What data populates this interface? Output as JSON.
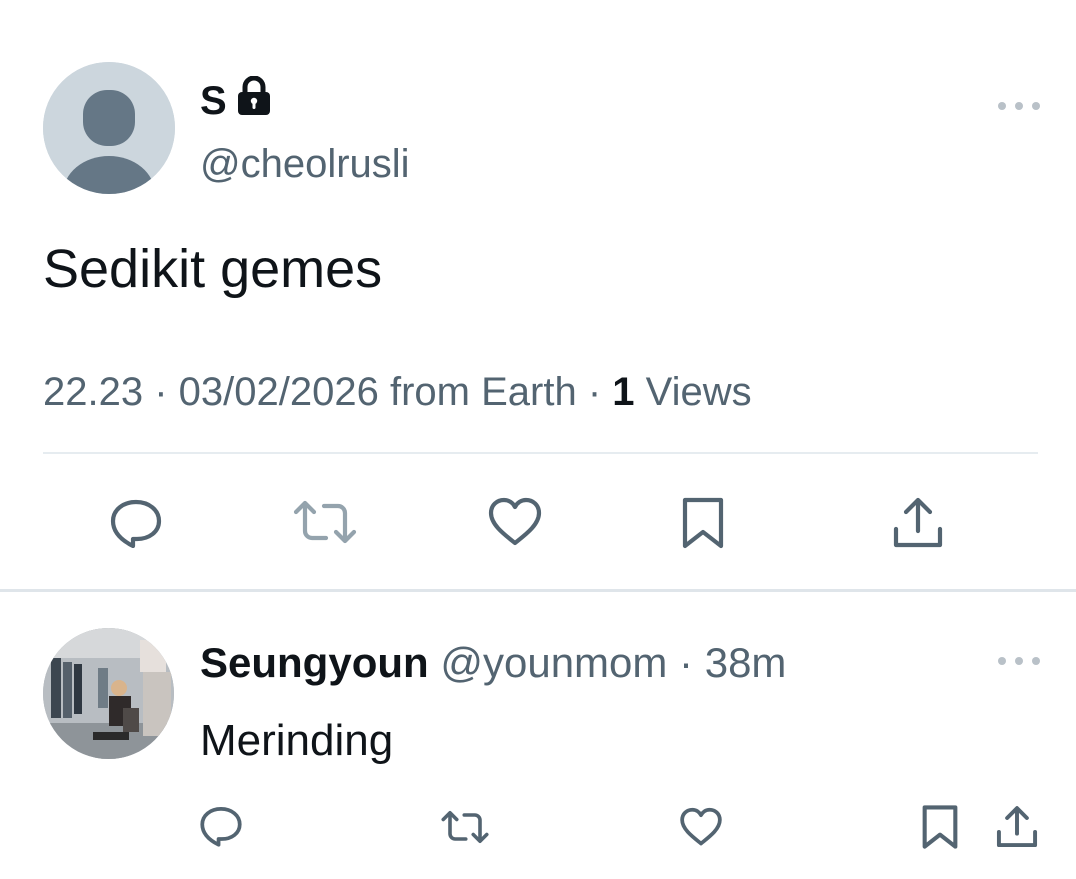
{
  "tweet": {
    "author_name": "S",
    "author_handle": "@cheolrusli",
    "text": "Sedikit gemes",
    "time": "22.23",
    "separator": " · ",
    "date": "03/02/2026",
    "source": " from Earth",
    "views_count": "1",
    "views_label": " Views",
    "lock_icon": "lock-icon",
    "more_icon": "more-horizontal-icon"
  },
  "actions": [
    "reply-icon",
    "retweet-icon",
    "like-icon",
    "bookmark-icon",
    "share-icon"
  ],
  "reply": {
    "author_name": "Seungyoun",
    "author_handle": "@younmom",
    "separator": " · ",
    "time": "38m",
    "text": "Merinding"
  },
  "colors": {
    "text_primary": "#0f1419",
    "text_secondary": "#536471",
    "icon": "#536471",
    "divider": "#e6ecf0",
    "avatar_placeholder": "#ccd6dd"
  }
}
